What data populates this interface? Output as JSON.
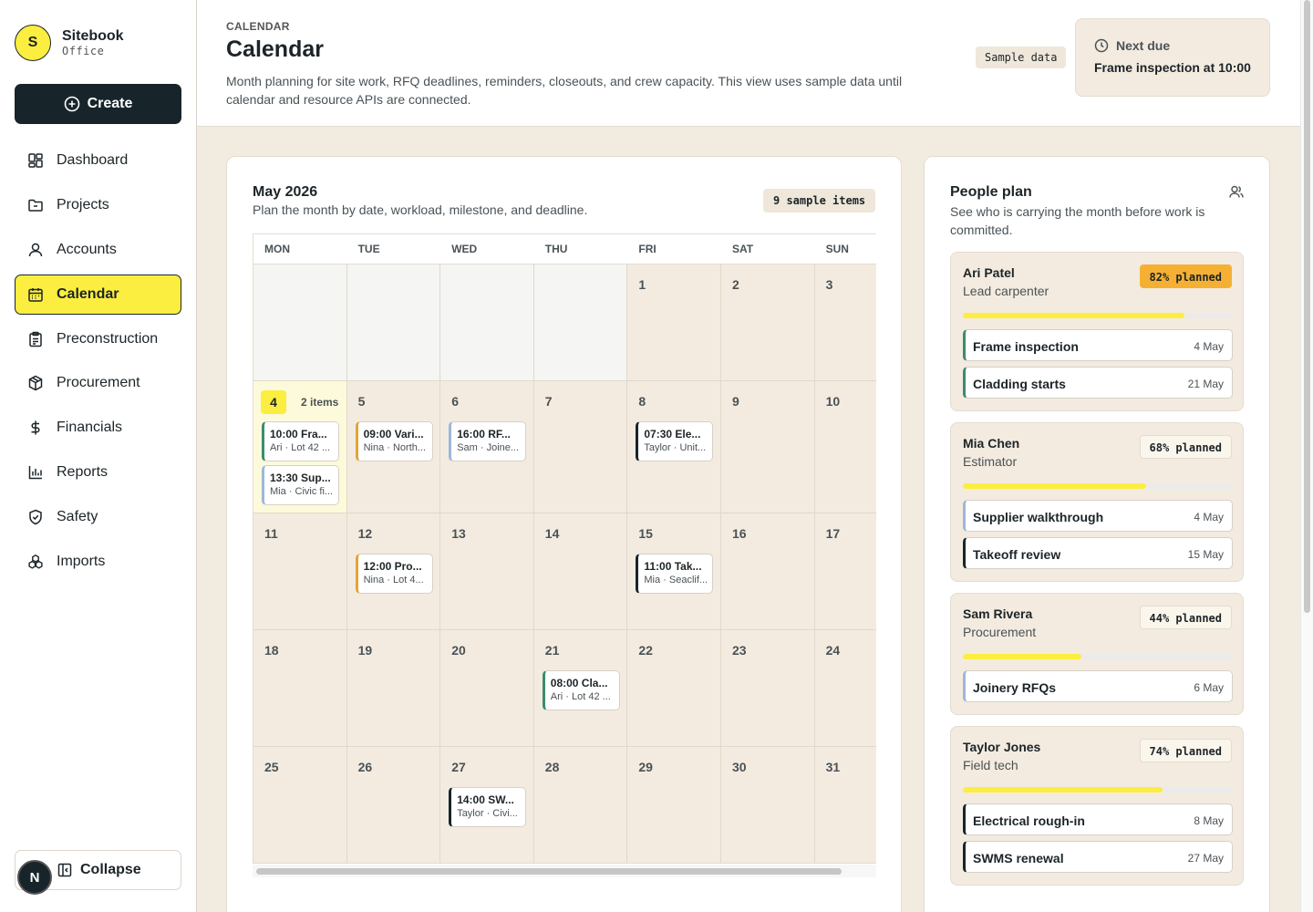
{
  "brand": {
    "initial": "S",
    "name": "Sitebook",
    "sub": "Office"
  },
  "sidebar": {
    "create_label": "Create",
    "items": [
      {
        "label": "Dashboard",
        "icon": "dashboard-icon"
      },
      {
        "label": "Projects",
        "icon": "folder-icon"
      },
      {
        "label": "Accounts",
        "icon": "user-icon"
      },
      {
        "label": "Calendar",
        "icon": "calendar-icon",
        "active": true
      },
      {
        "label": "Preconstruction",
        "icon": "clipboard-icon"
      },
      {
        "label": "Procurement",
        "icon": "package-icon"
      },
      {
        "label": "Financials",
        "icon": "dollar-icon"
      },
      {
        "label": "Reports",
        "icon": "chart-icon"
      },
      {
        "label": "Safety",
        "icon": "shield-icon"
      },
      {
        "label": "Imports",
        "icon": "boxes-icon"
      }
    ],
    "collapse_label": "Collapse",
    "avatar_initial": "N"
  },
  "header": {
    "eyebrow": "CALENDAR",
    "title": "Calendar",
    "description": "Month planning for site work, RFQ deadlines, reminders, closeouts, and crew capacity. This view uses sample data until calendar and resource APIs are connected.",
    "sample_badge": "Sample data",
    "next_due_label": "Next due",
    "next_due_value": "Frame inspection at 10:00"
  },
  "calendar": {
    "title": "May 2026",
    "subtitle": "Plan the month by date, workload, milestone, and deadline.",
    "items_badge": "9 sample items",
    "weekdays": [
      "MON",
      "TUE",
      "WED",
      "THU",
      "FRI",
      "SAT",
      "SUN"
    ],
    "today_count": "2 items",
    "weeks": [
      [
        "",
        "",
        "",
        "",
        "1",
        "2",
        "3"
      ],
      [
        "4",
        "5",
        "6",
        "7",
        "8",
        "9",
        "10"
      ],
      [
        "11",
        "12",
        "13",
        "14",
        "15",
        "16",
        "17"
      ],
      [
        "18",
        "19",
        "20",
        "21",
        "22",
        "23",
        "24"
      ],
      [
        "25",
        "26",
        "27",
        "28",
        "29",
        "30",
        "31"
      ]
    ],
    "events": {
      "e1": {
        "time": "10:00 Fra...",
        "meta": "Ari · Lot 42 ..."
      },
      "e2": {
        "time": "13:30 Sup...",
        "meta": "Mia · Civic fi..."
      },
      "e3": {
        "time": "09:00 Vari...",
        "meta": "Nina · North..."
      },
      "e4": {
        "time": "16:00 RF...",
        "meta": "Sam · Joine..."
      },
      "e5": {
        "time": "07:30 Ele...",
        "meta": "Taylor · Unit..."
      },
      "e6": {
        "time": "12:00 Pro...",
        "meta": "Nina · Lot 4..."
      },
      "e7": {
        "time": "11:00 Tak...",
        "meta": "Mia · Seaclif..."
      },
      "e8": {
        "time": "08:00 Cla...",
        "meta": "Ari · Lot 42 ..."
      },
      "e9": {
        "time": "14:00 SW...",
        "meta": "Taylor · Civi..."
      }
    }
  },
  "people": {
    "title": "People plan",
    "subtitle": "See who is carrying the month before work is committed.",
    "list": [
      {
        "name": "Ari Patel",
        "role": "Lead carpenter",
        "badge": "82% planned",
        "planned": 0.82,
        "tasks": [
          {
            "name": "Frame inspection",
            "date": "4 May"
          },
          {
            "name": "Cladding starts",
            "date": "21 May"
          }
        ]
      },
      {
        "name": "Mia Chen",
        "role": "Estimator",
        "badge": "68% planned",
        "planned": 0.68,
        "tasks": [
          {
            "name": "Supplier walkthrough",
            "date": "4 May"
          },
          {
            "name": "Takeoff review",
            "date": "15 May"
          }
        ]
      },
      {
        "name": "Sam Rivera",
        "role": "Procurement",
        "badge": "44% planned",
        "planned": 0.44,
        "tasks": [
          {
            "name": "Joinery RFQs",
            "date": "6 May"
          }
        ]
      },
      {
        "name": "Taylor Jones",
        "role": "Field tech",
        "badge": "74% planned",
        "planned": 0.74,
        "tasks": [
          {
            "name": "Electrical rough-in",
            "date": "8 May"
          },
          {
            "name": "SWMS renewal",
            "date": "27 May"
          }
        ]
      }
    ]
  },
  "colors": {
    "accent": "#fbee40",
    "dark": "#17252b",
    "warm_bg": "#f3ebdf",
    "hot": "#f5b034"
  }
}
